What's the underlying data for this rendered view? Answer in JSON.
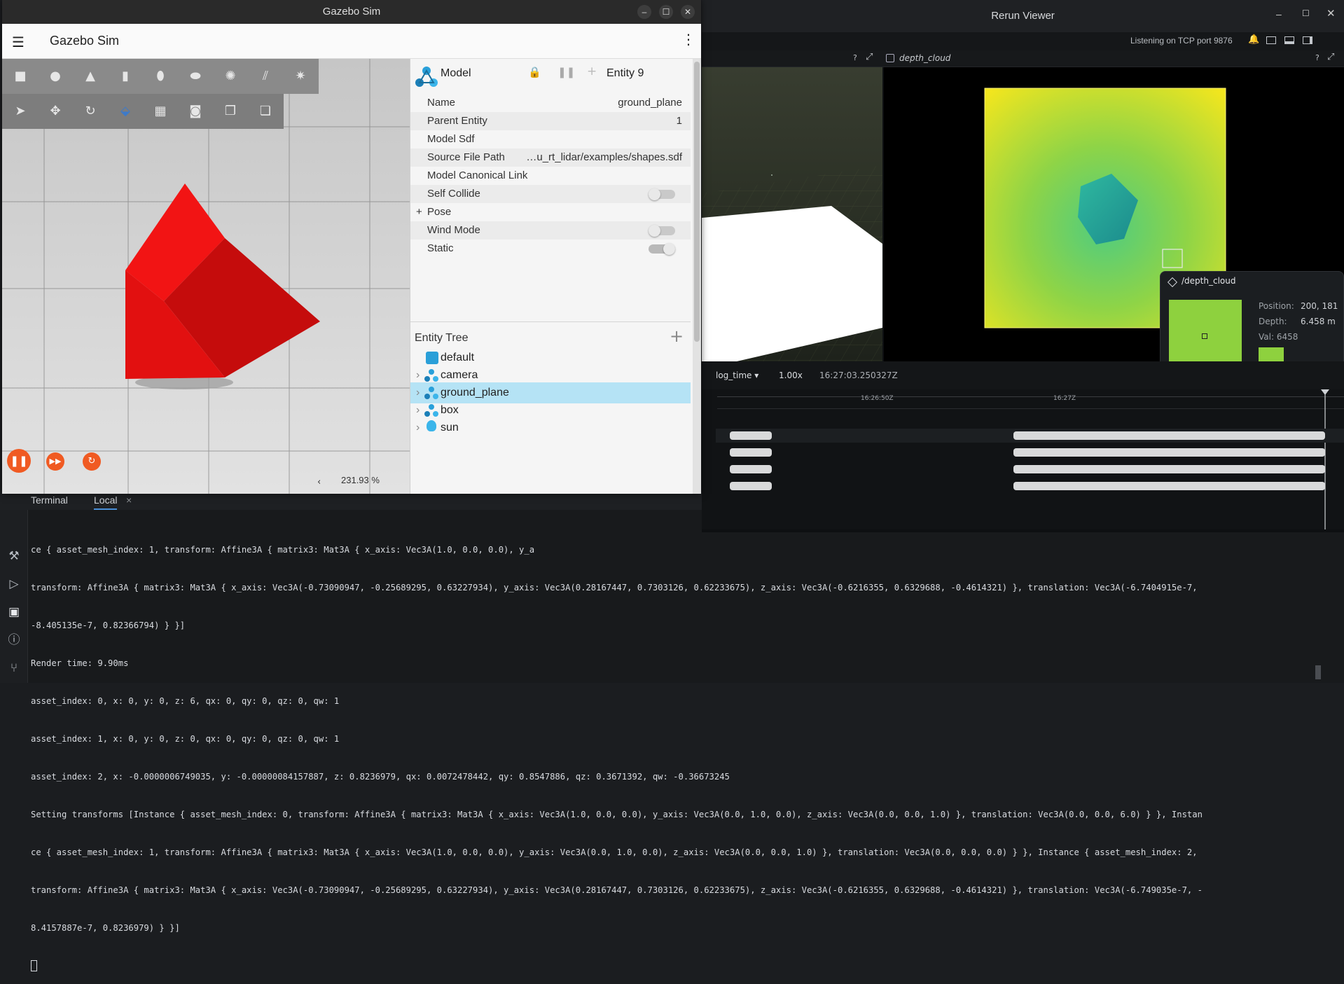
{
  "gazebo": {
    "window_title": "Gazebo Sim",
    "app_title": "Gazebo Sim",
    "zoom_label": "231.93 %",
    "component_panel": {
      "header": "Model",
      "entity_label": "Entity 9",
      "rows": [
        {
          "key": "Name",
          "value": "ground_plane"
        },
        {
          "key": "Parent Entity",
          "value": "1"
        },
        {
          "key": "Model Sdf",
          "value": ""
        },
        {
          "key": "Source File Path",
          "value": "…u_rt_lidar/examples/shapes.sdf"
        },
        {
          "key": "Model Canonical Link",
          "value": ""
        },
        {
          "key": "Self Collide",
          "toggle": false
        },
        {
          "key": "Pose",
          "expandable": true
        },
        {
          "key": "Wind Mode",
          "toggle": false
        },
        {
          "key": "Static",
          "toggle": true
        }
      ]
    },
    "entity_tree": {
      "title": "Entity Tree",
      "items": [
        {
          "label": "default",
          "icon": "world-cube-icon",
          "selected": false
        },
        {
          "label": "camera",
          "icon": "model-icon",
          "selected": false
        },
        {
          "label": "ground_plane",
          "icon": "model-icon",
          "selected": true
        },
        {
          "label": "box",
          "icon": "model-icon",
          "selected": false
        },
        {
          "label": "sun",
          "icon": "light-bulb-icon",
          "selected": false
        }
      ]
    },
    "toolbar_top": [
      "box-shape-icon",
      "sphere-shape-icon",
      "cone-shape-icon",
      "cylinder-shape-icon",
      "capsule-shape-icon",
      "ellipsoid-shape-icon",
      "point-light-icon",
      "directional-light-icon",
      "spot-light-icon"
    ],
    "toolbar_bottom": [
      "select-arrow-icon",
      "translate-icon",
      "rotate-icon",
      "transform-icon",
      "grid-snap-icon",
      "screenshot-icon",
      "copy-icon",
      "paste-icon"
    ],
    "colors": {
      "accent": "#f05a22",
      "selection": "#b5e3f5",
      "box": "#e81010"
    }
  },
  "terminal": {
    "tabs": [
      "Terminal",
      "Local"
    ],
    "lines": [
      "ce { asset_mesh_index: 1, transform: Affine3A { matrix3: Mat3A { x_axis: Vec3A(1.0, 0.0, 0.0), y_a",
      "transform: Affine3A { matrix3: Mat3A { x_axis: Vec3A(-0.73090947, -0.25689295, 0.63227934), y_axis: Vec3A(0.28167447, 0.7303126, 0.62233675), z_axis: Vec3A(-0.6216355, 0.6329688, -0.4614321) }, translation: Vec3A(-6.7404915e-7,",
      "-8.405135e-7, 0.82366794) } }]",
      "Render time: 9.90ms",
      "asset_index: 0, x: 0, y: 0, z: 6, qx: 0, qy: 0, qz: 0, qw: 1",
      "asset_index: 1, x: 0, y: 0, z: 0, qx: 0, qy: 0, qz: 0, qw: 1",
      "asset_index: 2, x: -0.0000006749035, y: -0.00000084157887, z: 0.8236979, qx: 0.0072478442, qy: 0.8547886, qz: 0.3671392, qw: -0.36673245",
      "Setting transforms [Instance { asset_mesh_index: 0, transform: Affine3A { matrix3: Mat3A { x_axis: Vec3A(1.0, 0.0, 0.0), y_axis: Vec3A(0.0, 1.0, 0.0), z_axis: Vec3A(0.0, 0.0, 1.0) }, translation: Vec3A(0.0, 0.0, 6.0) } }, Instan",
      "ce { asset_mesh_index: 1, transform: Affine3A { matrix3: Mat3A { x_axis: Vec3A(1.0, 0.0, 0.0), y_axis: Vec3A(0.0, 1.0, 0.0), z_axis: Vec3A(0.0, 0.0, 1.0) }, translation: Vec3A(0.0, 0.0, 0.0) } }, Instance { asset_mesh_index: 2,",
      "transform: Affine3A { matrix3: Mat3A { x_axis: Vec3A(-0.73090947, -0.25689295, 0.63227934), y_axis: Vec3A(0.28167447, 0.7303126, 0.62233675), z_axis: Vec3A(-0.6216355, 0.6329688, -0.4614321) }, translation: Vec3A(-6.749035e-7, -",
      "8.4157887e-7, 0.8236979) } }]"
    ],
    "side_icons": [
      "tools-icon",
      "run-icon",
      "terminal-icon",
      "problems-icon",
      "git-icon"
    ]
  },
  "rerun": {
    "window_title": "Rerun Viewer",
    "status": "Listening on TCP port 9876",
    "pane_title": "depth_cloud",
    "help": "?",
    "timeline": {
      "source": "log_time",
      "speed": "1.00x",
      "current_time": "16:27:03.250327Z",
      "tick_labels": [
        "16:26:50Z",
        "16:27Z"
      ]
    },
    "tooltip": {
      "entity": "/depth_cloud",
      "position_label": "Position:",
      "position_value": "200, 181",
      "depth_label": "Depth:",
      "depth_value": "6.458 m",
      "val_label": "Val: 6458"
    }
  }
}
